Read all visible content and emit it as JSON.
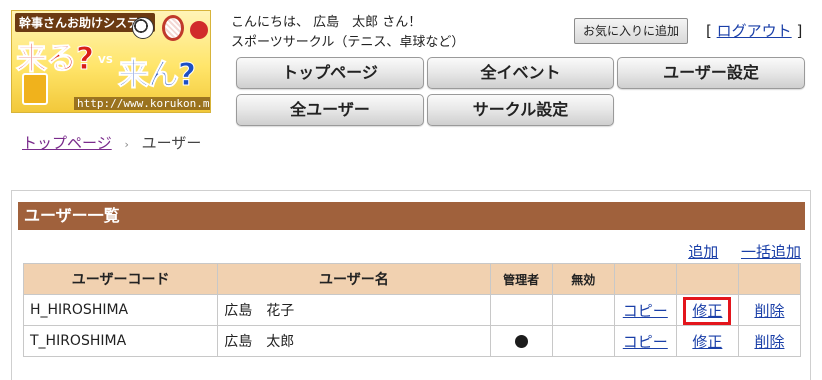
{
  "logo": {
    "tagline": "幹事さんお助けシステム",
    "main_left": "来る?",
    "vs": "VS",
    "main_right": "来ん?",
    "url": "http://www.korukon.me"
  },
  "header": {
    "greeting": "こんにちは、 広島　太郎 さん！",
    "circle_name": "スポーツサークル（テニス、卓球など）",
    "favorite_label": "お気に入りに追加",
    "logout_bracket_open": "[",
    "logout_label": "ログアウト",
    "logout_bracket_close": "]"
  },
  "nav": [
    {
      "label": "トップページ"
    },
    {
      "label": "全イベント"
    },
    {
      "label": "ユーザー設定"
    },
    {
      "label": "全ユーザー"
    },
    {
      "label": "サークル設定"
    }
  ],
  "breadcrumb": {
    "home": "トップページ",
    "separator": "›",
    "current": "ユーザー"
  },
  "panel": {
    "title": "ユーザー一覧",
    "add_label": "追加",
    "bulk_add_label": "一括追加"
  },
  "table": {
    "headers": {
      "code": "ユーザーコード",
      "name": "ユーザー名",
      "admin": "管理者",
      "disabled": "無効"
    },
    "rows": [
      {
        "code": "H_HIROSHIMA",
        "name": "広島　花子",
        "admin": false,
        "disabled": false,
        "copy": "コピー",
        "edit": "修正",
        "delete": "削除",
        "edit_highlighted": true
      },
      {
        "code": "T_HIROSHIMA",
        "name": "広島　太郎",
        "admin": true,
        "disabled": false,
        "copy": "コピー",
        "edit": "修正",
        "delete": "削除",
        "edit_highlighted": false
      }
    ]
  },
  "colors": {
    "panel_header": "#a0613c",
    "table_header": "#f1d1b0",
    "link": "#1a3fa8",
    "highlight": "#e3151c"
  }
}
